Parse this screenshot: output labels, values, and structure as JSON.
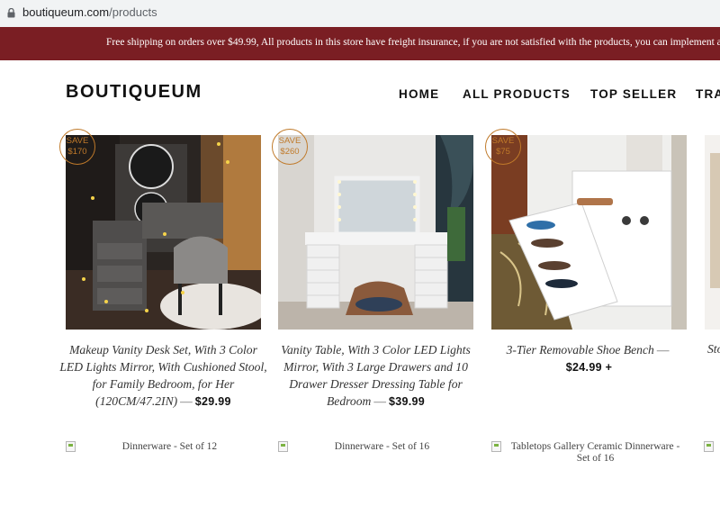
{
  "browser": {
    "domain": "boutiqueum.com",
    "path": "/products"
  },
  "announcement": {
    "text": "Free shipping on orders over $49.99, All products in this store have freight insurance, if you are not satisfied with the products, you can implement a"
  },
  "header": {
    "logo": "BOUTIQUEUM",
    "nav": [
      "HOME",
      "ALL PRODUCTS",
      "TOP SELLER",
      "TRA"
    ]
  },
  "products": [
    {
      "badge_save": "SAVE",
      "badge_amount": "$170",
      "title": "Makeup Vanity Desk Set, With 3 Color LED Lights Mirror, With Cushioned Stool, for Family Bedroom, for Her (120CM/47.2IN)",
      "separator": "—",
      "price": "$29.99"
    },
    {
      "badge_save": "SAVE",
      "badge_amount": "$260",
      "title": "Vanity Table, With 3 Color LED Lights Mirror, With 3 Large Drawers and 10 Drawer Dresser Dressing Table for Bedroom",
      "separator": "—",
      "price": "$39.99"
    },
    {
      "badge_save": "SAVE",
      "badge_amount": "$75",
      "title": "3-Tier Removable Shoe Bench",
      "separator": "—",
      "price": "$24.99 +"
    }
  ],
  "edge_product_title": "Sto",
  "row2_alt": [
    "Dinnerware - Set of 12",
    "Dinnerware - Set of 16",
    "Tabletops Gallery Ceramic Dinnerware - Set of 16"
  ],
  "colors": {
    "announcement_bg": "#7a1e23",
    "badge": "#c07a2a"
  }
}
